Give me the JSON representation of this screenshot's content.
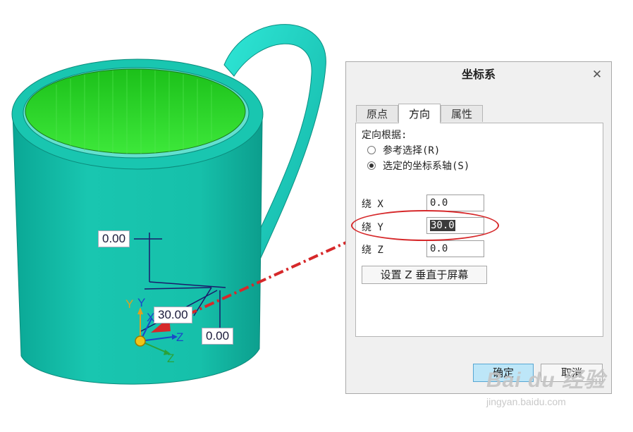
{
  "viewport": {
    "dimensions": [
      "0.00",
      "30.00",
      "0.00"
    ],
    "axes": {
      "y_orange": "Y",
      "y_blue": "Y",
      "x": "X",
      "z_blue": "Z",
      "z_green": "Z"
    }
  },
  "dialog": {
    "title": "坐标系",
    "tabs": [
      "原点",
      "方向",
      "属性"
    ],
    "active_tab": "方向",
    "orient_by_label": "定向根据:",
    "radios": [
      {
        "label": "参考选择(R)",
        "checked": false
      },
      {
        "label": "选定的坐标系轴(S)",
        "checked": true
      }
    ],
    "rotations": [
      {
        "label": "绕 X",
        "value": "0.0"
      },
      {
        "label": "绕 Y",
        "value": "30.0"
      },
      {
        "label": "绕 Z",
        "value": "0.0"
      }
    ],
    "set_z_button": "设置 Z 垂直于屏幕",
    "ok_button": "确定",
    "cancel_button": "取消"
  },
  "watermark": {
    "logo": "Bai du 经验",
    "site": "jingyan.baidu.com"
  },
  "colors": {
    "mug": "#15c3ad",
    "mug_inner": "#2fd82a",
    "handle": "#1fd2c4",
    "annotation": "#d6282a",
    "dim_lines": "#1a1a6a"
  }
}
